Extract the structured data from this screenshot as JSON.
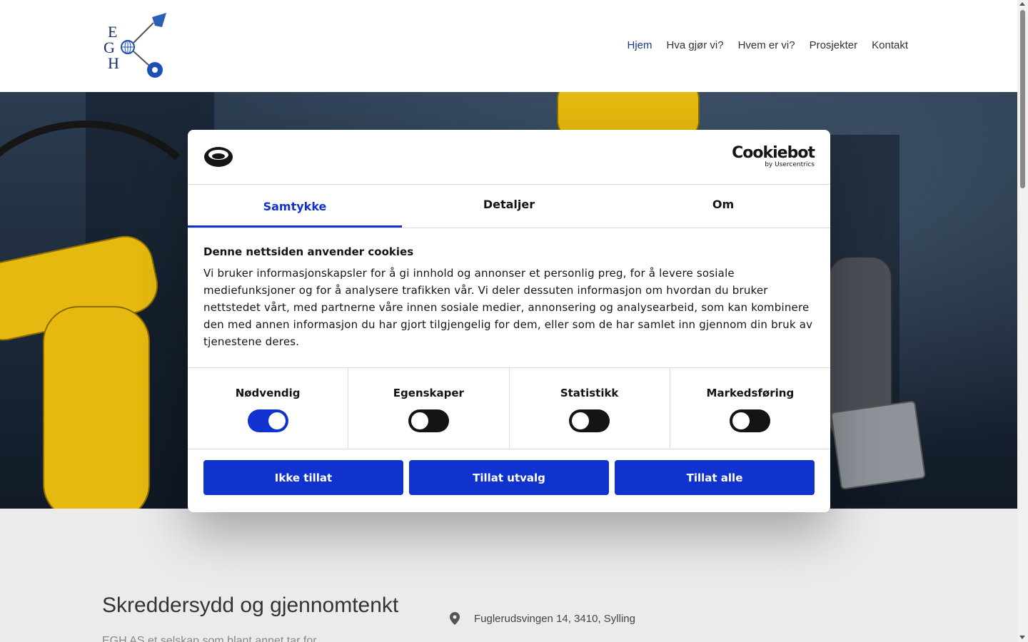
{
  "nav": {
    "items": [
      "Hjem",
      "Hva gjør vi?",
      "Hvem er vi?",
      "Prosjekter",
      "Kontakt"
    ]
  },
  "logo": {
    "letters": [
      "E",
      "G",
      "H"
    ]
  },
  "content": {
    "title": "Skreddersydd og gjennomtenkt",
    "subtitle": "EGH AS et selskap som blant annet tar for",
    "address": "Fuglerudsvingen 14, 3410, Sylling"
  },
  "cookie": {
    "brand": "Cookiebot",
    "brand_sub": "by Usercentrics",
    "tabs": [
      "Samtykke",
      "Detaljer",
      "Om"
    ],
    "heading": "Denne nettsiden anvender cookies",
    "text": "Vi bruker informasjonskapsler for å gi innhold og annonser et personlig preg, for å levere sosiale mediefunksjoner og for å analysere trafikken vår. Vi deler dessuten informasjon om hvordan du bruker nettstedet vårt, med partnerne våre innen sosiale medier, annonsering og analysearbeid, som kan kombinere den med annen informasjon du har gjort tilgjengelig for dem, eller som de har samlet inn gjennom din bruk av tjenestene deres.",
    "categories": [
      {
        "label": "Nødvendig",
        "on": true
      },
      {
        "label": "Egenskaper",
        "on": false
      },
      {
        "label": "Statistikk",
        "on": false
      },
      {
        "label": "Markedsføring",
        "on": false
      }
    ],
    "buttons": [
      "Ikke tillat",
      "Tillat utvalg",
      "Tillat alle"
    ]
  },
  "colors": {
    "accent": "#1032cf",
    "nav_active": "#1a3a8a",
    "arm": "#e5b90f"
  }
}
